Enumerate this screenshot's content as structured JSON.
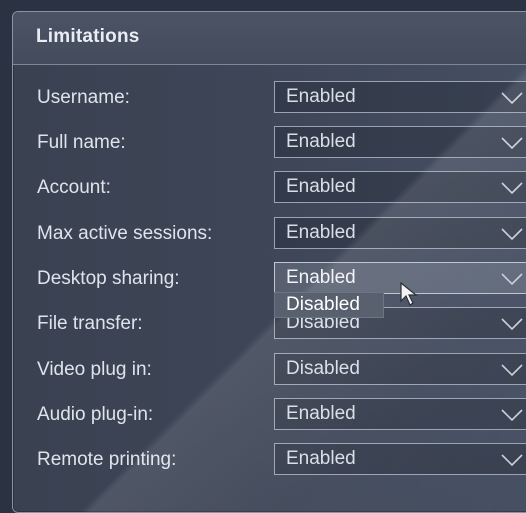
{
  "panel": {
    "title": "Limitations"
  },
  "rows": [
    {
      "label": "Username:",
      "value": "Enabled"
    },
    {
      "label": "Full name:",
      "value": "Enabled"
    },
    {
      "label": "Account:",
      "value": "Enabled"
    },
    {
      "label": "Max active sessions:",
      "value": "Enabled"
    },
    {
      "label": "Desktop sharing:",
      "value": "Enabled"
    },
    {
      "label": "File transfer:",
      "value": "Disabled"
    },
    {
      "label": "Video plug in:",
      "value": "Disabled"
    },
    {
      "label": "Audio plug-in:",
      "value": "Enabled"
    },
    {
      "label": "Remote printing:",
      "value": "Enabled"
    }
  ],
  "dropdown": {
    "options": [
      "Disabled"
    ]
  },
  "icons": {
    "chevron": "chevron-down-icon",
    "cursor": "mouse-pointer-icon"
  }
}
